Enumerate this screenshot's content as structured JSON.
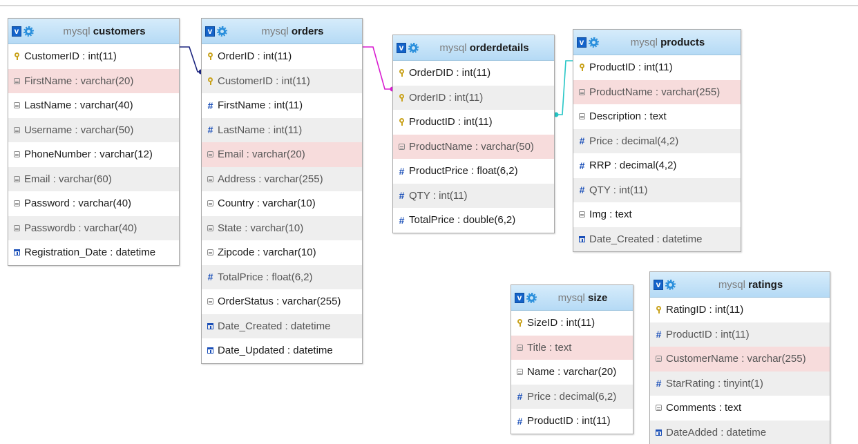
{
  "colors": {
    "header_gradient_top": "#d6ecfb",
    "header_gradient_bottom": "#b5daf5",
    "highlight_row": "#f7dcdc",
    "alt_row": "#eeeeee",
    "link_customers_orders": "#1a237e",
    "link_orders_orderdetails": "#d81bd0",
    "link_orderdetails_products": "#26c6c6"
  },
  "tables": [
    {
      "id": "customers",
      "db": "mysql",
      "name": "customers",
      "fields": [
        {
          "text": "CustomerID : int(11)",
          "icon": "key-icon",
          "style": "normal"
        },
        {
          "text": "FirstName : varchar(20)",
          "icon": "text-field-icon",
          "style": "hl"
        },
        {
          "text": "LastName : varchar(40)",
          "icon": "text-field-icon",
          "style": "normal"
        },
        {
          "text": "Username : varchar(50)",
          "icon": "text-field-icon",
          "style": "alt"
        },
        {
          "text": "PhoneNumber : varchar(12)",
          "icon": "text-field-icon",
          "style": "normal"
        },
        {
          "text": "Email : varchar(60)",
          "icon": "text-field-icon",
          "style": "alt"
        },
        {
          "text": "Password : varchar(40)",
          "icon": "text-field-icon",
          "style": "normal"
        },
        {
          "text": "Passwordb : varchar(40)",
          "icon": "text-field-icon",
          "style": "alt"
        },
        {
          "text": "Registration_Date : datetime",
          "icon": "date-field-icon",
          "style": "normal"
        }
      ]
    },
    {
      "id": "orders",
      "db": "mysql",
      "name": "orders",
      "fields": [
        {
          "text": "OrderID : int(11)",
          "icon": "key-icon",
          "style": "normal"
        },
        {
          "text": "CustomerID : int(11)",
          "icon": "key-icon",
          "style": "alt"
        },
        {
          "text": "FirstName : int(11)",
          "icon": "numeric-field-icon",
          "style": "normal"
        },
        {
          "text": "LastName : int(11)",
          "icon": "numeric-field-icon",
          "style": "alt"
        },
        {
          "text": "Email : varchar(20)",
          "icon": "text-field-icon",
          "style": "hl"
        },
        {
          "text": "Address : varchar(255)",
          "icon": "text-field-icon",
          "style": "alt"
        },
        {
          "text": "Country : varchar(10)",
          "icon": "text-field-icon",
          "style": "normal"
        },
        {
          "text": "State : varchar(10)",
          "icon": "text-field-icon",
          "style": "alt"
        },
        {
          "text": "Zipcode : varchar(10)",
          "icon": "text-field-icon",
          "style": "normal"
        },
        {
          "text": "TotalPrice : float(6,2)",
          "icon": "numeric-field-icon",
          "style": "alt"
        },
        {
          "text": "OrderStatus : varchar(255)",
          "icon": "text-field-icon",
          "style": "normal"
        },
        {
          "text": "Date_Created : datetime",
          "icon": "date-field-icon",
          "style": "alt"
        },
        {
          "text": "Date_Updated : datetime",
          "icon": "date-field-icon",
          "style": "normal"
        }
      ]
    },
    {
      "id": "orderdetails",
      "db": "mysql",
      "name": "orderdetails",
      "fields": [
        {
          "text": "OrderDID : int(11)",
          "icon": "key-icon",
          "style": "normal"
        },
        {
          "text": "OrderID : int(11)",
          "icon": "key-icon",
          "style": "alt"
        },
        {
          "text": "ProductID : int(11)",
          "icon": "key-icon",
          "style": "normal"
        },
        {
          "text": "ProductName : varchar(50)",
          "icon": "text-field-icon",
          "style": "hl"
        },
        {
          "text": "ProductPrice : float(6,2)",
          "icon": "numeric-field-icon",
          "style": "normal"
        },
        {
          "text": "QTY : int(11)",
          "icon": "numeric-field-icon",
          "style": "alt"
        },
        {
          "text": "TotalPrice : double(6,2)",
          "icon": "numeric-field-icon",
          "style": "normal"
        }
      ]
    },
    {
      "id": "products",
      "db": "mysql",
      "name": "products",
      "fields": [
        {
          "text": "ProductID : int(11)",
          "icon": "key-icon",
          "style": "normal"
        },
        {
          "text": "ProductName : varchar(255)",
          "icon": "text-field-icon",
          "style": "hl"
        },
        {
          "text": "Description : text",
          "icon": "text-field-icon",
          "style": "normal"
        },
        {
          "text": "Price : decimal(4,2)",
          "icon": "numeric-field-icon",
          "style": "alt"
        },
        {
          "text": "RRP : decimal(4,2)",
          "icon": "numeric-field-icon",
          "style": "normal"
        },
        {
          "text": "QTY : int(11)",
          "icon": "numeric-field-icon",
          "style": "alt"
        },
        {
          "text": "Img : text",
          "icon": "text-field-icon",
          "style": "normal"
        },
        {
          "text": "Date_Created : datetime",
          "icon": "date-field-icon",
          "style": "alt"
        }
      ]
    },
    {
      "id": "size",
      "db": "mysql",
      "name": "size",
      "fields": [
        {
          "text": "SizeID : int(11)",
          "icon": "key-icon",
          "style": "normal"
        },
        {
          "text": "Title : text",
          "icon": "text-field-icon",
          "style": "hl"
        },
        {
          "text": "Name : varchar(20)",
          "icon": "text-field-icon",
          "style": "normal"
        },
        {
          "text": "Price : decimal(6,2)",
          "icon": "numeric-field-icon",
          "style": "alt"
        },
        {
          "text": "ProductID : int(11)",
          "icon": "numeric-field-icon",
          "style": "normal"
        }
      ]
    },
    {
      "id": "ratings",
      "db": "mysql",
      "name": "ratings",
      "fields": [
        {
          "text": "RatingID : int(11)",
          "icon": "key-icon",
          "style": "normal"
        },
        {
          "text": "ProductID : int(11)",
          "icon": "numeric-field-icon",
          "style": "alt"
        },
        {
          "text": "CustomerName : varchar(255)",
          "icon": "text-field-icon",
          "style": "hl"
        },
        {
          "text": "StarRating : tinyint(1)",
          "icon": "numeric-field-icon",
          "style": "alt"
        },
        {
          "text": "Comments : text",
          "icon": "text-field-icon",
          "style": "normal"
        },
        {
          "text": "DateAdded : datetime",
          "icon": "date-field-icon",
          "style": "alt"
        }
      ]
    }
  ],
  "relations": [
    {
      "from": "customers.CustomerID",
      "to": "orders.CustomerID",
      "color_key": "link_customers_orders"
    },
    {
      "from": "orders.OrderID",
      "to": "orderdetails.OrderID",
      "color_key": "link_orders_orderdetails"
    },
    {
      "from": "orderdetails.ProductID",
      "to": "products.ProductID",
      "color_key": "link_orderdetails_products"
    }
  ]
}
